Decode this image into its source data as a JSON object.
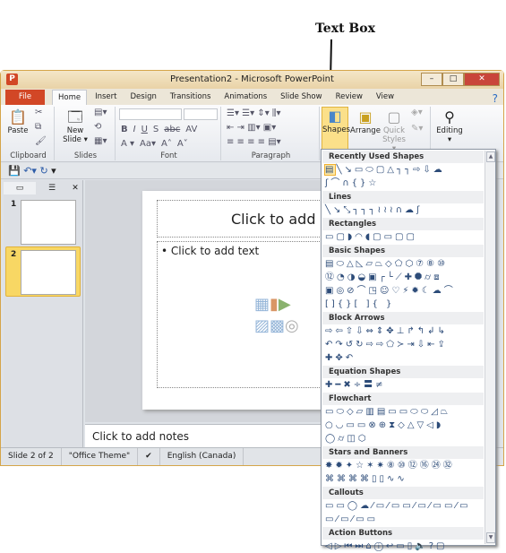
{
  "annotation": {
    "label": "Text Box"
  },
  "window": {
    "title": "Presentation2  -  Microsoft PowerPoint",
    "logo": "P",
    "minimize": "–",
    "maximize": "□",
    "close": "✕"
  },
  "tabs": [
    "File",
    "Home",
    "Insert",
    "Design",
    "Transitions",
    "Animations",
    "Slide Show",
    "Review",
    "View"
  ],
  "ribbon": {
    "clipboard": {
      "label": "Clipboard",
      "paste": "Paste"
    },
    "slides": {
      "label": "Slides",
      "new_slide_1": "New",
      "new_slide_2": "Slide ▾"
    },
    "font": {
      "label": "Font",
      "bold": "B",
      "italic": "I",
      "underline": "U",
      "shadow": "S",
      "strike": "abc",
      "spacing": "AV",
      "fontcolor": "A ▾",
      "case": "Aa▾",
      "grow": "A˄",
      "shrink": "A˅"
    },
    "paragraph": {
      "label": "Paragraph"
    },
    "drawing": {
      "shapes": "Shapes",
      "arrange": "Arrange",
      "quick_styles_1": "Quick",
      "quick_styles_2": "Styles ▾"
    },
    "editing": {
      "label": "Editing"
    }
  },
  "slides_panel": {
    "slides": [
      "1",
      "2"
    ],
    "selected": 2
  },
  "slide": {
    "title_placeholder": "Click to add title",
    "body_placeholder": "Click to add text",
    "bullet": "•"
  },
  "notes": {
    "placeholder": "Click to add notes"
  },
  "status": {
    "slide": "Slide 2 of 2",
    "theme": "\"Office Theme\"",
    "language": "English (Canada)"
  },
  "gallery": {
    "sections": [
      {
        "title": "Recently Used Shapes",
        "rows": [
          "▤╲↘▭⬭▢△┐┐⇨⇩☁",
          "ʃ⌒∩{}☆"
        ]
      },
      {
        "title": "Lines",
        "rows": [
          "╲↘⤡┐┐┐≀≀≀∩☁ʃ"
        ]
      },
      {
        "title": "Rectangles",
        "rows": [
          "▭▢◗◠◖▢▭▢▢"
        ]
      },
      {
        "title": "Basic Shapes",
        "rows": [
          "▤⬭△◺▱⏢◇⬠⬡⑦⑧⑩",
          "⑫◔◑◒▣┌└⟋✚⯃⌭⧈",
          "▣◎⊘⌒◳☺♡⚡✹☾☁⌒",
          "[]{}[ ]{ }"
        ]
      },
      {
        "title": "Block Arrows",
        "rows": [
          "⇨⇦⇧⇩⇔⇕✥⊥↱↰↲↳",
          "↶↷↺↻⇨⇨⬠≻⇥⇩⇤⇪",
          "✚✥↶"
        ]
      },
      {
        "title": "Equation Shapes",
        "rows": [
          "✚━✖÷〓≠"
        ]
      },
      {
        "title": "Flowchart",
        "rows": [
          "▭⬭◇▱▥▤▭▭⬭⬭◿⏢",
          "○◡▭▭⊗⊕⧗◇△▽◁◗",
          "◯⌭◫⬡"
        ]
      },
      {
        "title": "Stars and Banners",
        "rows": [
          "✸✹✦☆✶✷⑧⑩⑫⑯㉔㉜",
          "⌘⌘⌘⌘▯▯∿∿"
        ]
      },
      {
        "title": "Callouts",
        "rows": [
          "▭▭◯☁⁄▭⁄▭▭⁄▭⁄▭▭⁄▭",
          "▭⁄▭⁄▭▭"
        ]
      },
      {
        "title": "Action Buttons",
        "rows": [
          "◁▷⏮⏭⌂ⓘ↩▭▯🔈?▢"
        ]
      }
    ]
  },
  "colors": {
    "file_tab": "#d24726",
    "selected_thumb": "#f8d764",
    "frame": "#d5a54a"
  }
}
